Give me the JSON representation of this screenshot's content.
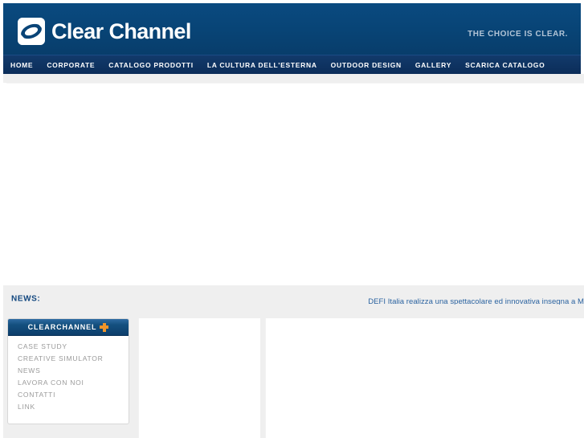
{
  "header": {
    "logo_icon": "clear-channel-swoosh-logo",
    "brand_name": "Clear Channel",
    "tagline": "THE CHOICE IS CLEAR.",
    "brand_blue": "#094477",
    "nav_blue": "#0c2f5c",
    "tagline_color": "#b2c4d6"
  },
  "nav": {
    "items": [
      {
        "label": "HOME"
      },
      {
        "label": "CORPORATE"
      },
      {
        "label": "CATALOGO PRODOTTI"
      },
      {
        "label": "LA CULTURA DELL'ESTERNA"
      },
      {
        "label": "OUTDOOR DESIGN"
      },
      {
        "label": "GALLERY"
      },
      {
        "label": "SCARICA CATALOGO"
      }
    ]
  },
  "news": {
    "label": "NEWS:",
    "ticker_text": "DEFI Italia realizza una spettacolare ed innovativa insegna a M",
    "label_color": "#12477f",
    "ticker_color": "#2b63a0",
    "bar_background": "#efefef"
  },
  "sidebar": {
    "header_title": "CLEARCHANNEL",
    "header_icon": "orange-plus-icon",
    "header_icon_color": "#f0952a",
    "items": [
      {
        "label": "CASE STUDY"
      },
      {
        "label": "CREATIVE SIMULATOR"
      },
      {
        "label": "NEWS"
      },
      {
        "label": "LAVORA CON NOI"
      },
      {
        "label": "CONTATTI"
      },
      {
        "label": "LINK"
      }
    ]
  },
  "panels": {
    "hero_content": "",
    "middle_content": "",
    "right_content": ""
  }
}
